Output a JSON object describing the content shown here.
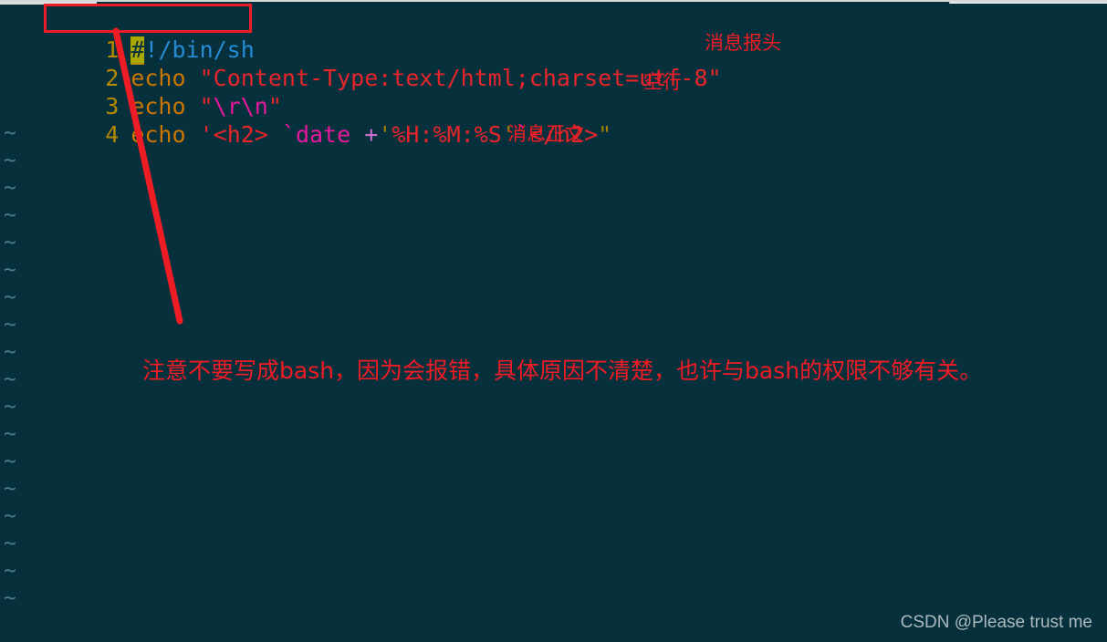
{
  "window": {
    "background_color": "#06303c",
    "chrome_strip_color": "#dcdfe0"
  },
  "editor": {
    "name": "vim",
    "lines": [
      {
        "number": "1",
        "tokens": [
          {
            "text": "#",
            "style": "comment-hash"
          },
          {
            "text": "!/bin/sh",
            "style": "shebang"
          }
        ],
        "plain": "#!/bin/sh"
      },
      {
        "number": "2",
        "tokens": [
          {
            "text": "echo",
            "style": "cmd"
          },
          {
            "text": " ",
            "style": "plain"
          },
          {
            "text": "\"Content-Type:text/html;charset=utf-8\"",
            "style": "str"
          }
        ],
        "plain": "echo \"Content-Type:text/html;charset=utf-8\""
      },
      {
        "number": "3",
        "tokens": [
          {
            "text": "echo",
            "style": "cmd"
          },
          {
            "text": " ",
            "style": "plain"
          },
          {
            "text": "\"",
            "style": "str"
          },
          {
            "text": "\\r\\n",
            "style": "esc"
          },
          {
            "text": "\"",
            "style": "str"
          }
        ],
        "plain": "echo \"\\r\\n\""
      },
      {
        "number": "4",
        "tokens": [
          {
            "text": "echo",
            "style": "cmd"
          },
          {
            "text": " ",
            "style": "plain"
          },
          {
            "text": "'<h2> ",
            "style": "str"
          },
          {
            "text": "`date",
            "style": "backtick"
          },
          {
            "text": " ",
            "style": "plain"
          },
          {
            "text": "+",
            "style": "plus"
          },
          {
            "text": "'",
            "style": "quote-y"
          },
          {
            "text": "%H:%M:%S",
            "style": "str"
          },
          {
            "text": "'",
            "style": "quote-y"
          },
          {
            "text": "`",
            "style": "backtick"
          },
          {
            "text": "</h2>",
            "style": "str"
          },
          {
            "text": "\"",
            "style": "dquote-y"
          }
        ],
        "plain": "echo '<h2> `date +'%H:%M:%S'`</h2>\""
      }
    ],
    "empty_line_marker": "~",
    "empty_line_count": 18
  },
  "annotations": {
    "header_note": "消息报头",
    "blank_line_note": "空行",
    "body_note": "消息正文",
    "bottom_note": "注意不要写成bash，因为会报错，具体原因不清楚，也许与bash的权限不够有关。",
    "color": "#ef1c26"
  },
  "callout": {
    "box_target": "#!/bin/sh",
    "box_color": "#ee1c25",
    "leader_line_color": "#ee1c25"
  },
  "watermark": {
    "text": "CSDN @Please trust me"
  }
}
